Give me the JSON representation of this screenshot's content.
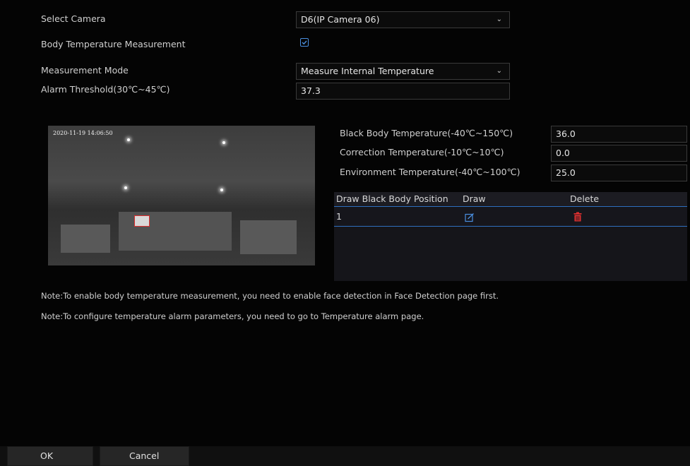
{
  "form": {
    "camera_label": "Select Camera",
    "camera_value": "D6(IP Camera 06)",
    "body_temp_label": "Body Temperature Measurement",
    "body_temp_checked": true,
    "mode_label": "Measurement Mode",
    "mode_value": "Measure Internal Temperature",
    "alarm_label": "Alarm Threshold(30℃~45℃)",
    "alarm_value": "37.3"
  },
  "preview": {
    "timestamp": "2020-11-19 14:06:50"
  },
  "blackbody": {
    "temp_label": "Black Body Temperature(-40℃~150℃)",
    "temp_value": "36.0",
    "correction_label": "Correction Temperature(-10℃~10℃)",
    "correction_value": "0.0",
    "environment_label": "Environment Temperature(-40℃~100℃)",
    "environment_value": "25.0"
  },
  "table": {
    "headers": [
      "Draw Black Body Position",
      "Draw",
      "Delete"
    ],
    "rows": [
      {
        "position": "1"
      }
    ]
  },
  "notes": [
    "Note:To enable body temperature measurement, you need to enable face detection in Face Detection page first.",
    "Note:To configure temperature alarm parameters, you need to go to Temperature alarm page."
  ],
  "buttons": {
    "ok": "OK",
    "cancel": "Cancel"
  },
  "colors": {
    "accent": "#4a8fe0",
    "delete": "#e03030",
    "background": "#040404"
  },
  "icons": {
    "draw": "edit-icon",
    "delete": "trash-icon",
    "dropdown": "chevron-down-icon"
  }
}
